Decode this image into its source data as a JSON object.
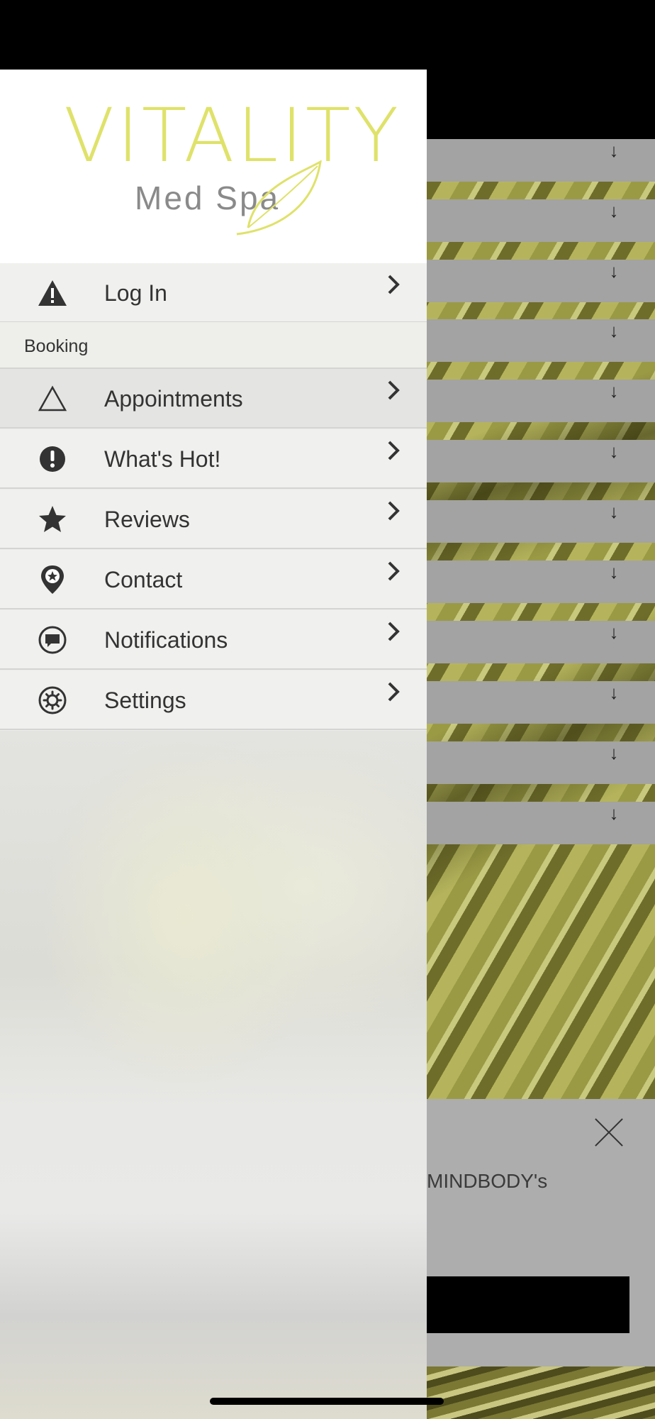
{
  "drawer": {
    "logo": {
      "title": "VITALITY",
      "subtitle": "Med Spa"
    },
    "login": {
      "label": "Log In",
      "icon": "warning-icon"
    },
    "section_booking": "Booking",
    "items": [
      {
        "label": "Appointments",
        "icon": "triangle-outline-icon"
      },
      {
        "label": "What's Hot!",
        "icon": "exclamation-circle-icon"
      },
      {
        "label": "Reviews",
        "icon": "star-icon"
      },
      {
        "label": "Contact",
        "icon": "map-pin-star-icon"
      },
      {
        "label": "Notifications",
        "icon": "chat-bubble-icon"
      },
      {
        "label": "Settings",
        "icon": "gear-icon"
      }
    ]
  },
  "background": {
    "banner_text": "MINDBODY's",
    "row_count": 12
  },
  "colors": {
    "logo_accent": "#dfe26a",
    "logo_gray": "#8a8a8a",
    "menu_text": "#333333"
  }
}
